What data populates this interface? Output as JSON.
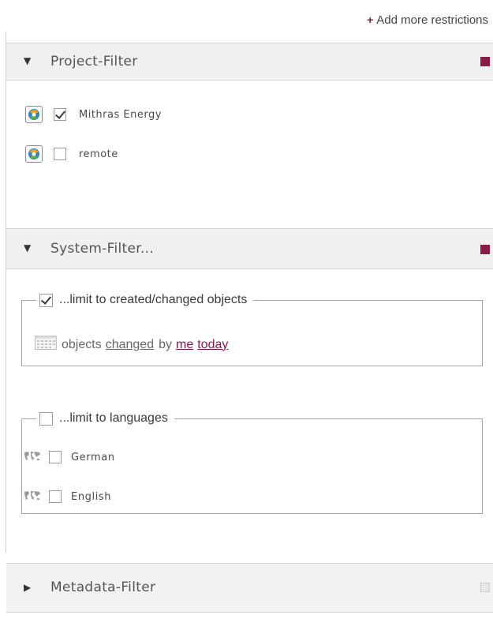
{
  "toolbar": {
    "add_label": "Add more restrictions",
    "add_icon": "plus-icon"
  },
  "project_filter": {
    "title": "Project-Filter",
    "expanded": true,
    "active": true,
    "projects": [
      {
        "label": "Mithras Energy",
        "checked": true,
        "icon": "project-globe-icon"
      },
      {
        "label": "remote",
        "checked": false,
        "icon": "project-globe-icon"
      }
    ]
  },
  "system_filter": {
    "title": "System-Filter...",
    "expanded": true,
    "active": true,
    "created_changed": {
      "legend": "...limit to created/changed objects",
      "checked": true,
      "sentence": {
        "prefix": "objects",
        "action": "changed",
        "by_text": "by",
        "user": "me",
        "when": "today"
      }
    },
    "languages": {
      "legend": "...limit to languages",
      "checked": false,
      "items": [
        {
          "label": "German",
          "checked": false,
          "icon": "world-map-icon"
        },
        {
          "label": "English",
          "checked": false,
          "icon": "world-map-icon"
        }
      ]
    }
  },
  "metadata_filter": {
    "title": "Metadata-Filter",
    "expanded": false,
    "active": false
  },
  "colors": {
    "accent": "#8b1a47",
    "header_bg": "#f0f0f0",
    "border": "#d6d6d6"
  }
}
